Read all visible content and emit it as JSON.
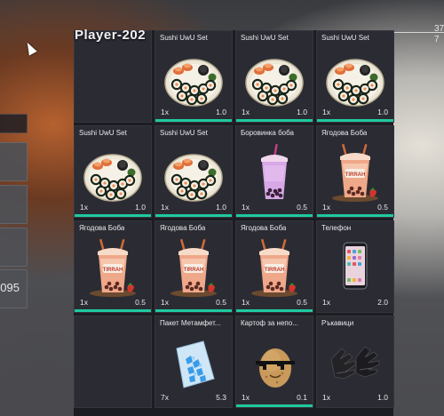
{
  "player_name": "Player-202",
  "left_panel_value": "095",
  "right_edge": {
    "line1": "37",
    "line2": "7"
  },
  "accent_color": "#1fc9a0",
  "slots": [
    {
      "kind": "empty"
    },
    {
      "kind": "item",
      "name": "Sushi UwU Set",
      "qty": "1x",
      "weight": "1.0",
      "icon": "sushi-platter",
      "bar": true
    },
    {
      "kind": "item",
      "name": "Sushi UwU Set",
      "qty": "1x",
      "weight": "1.0",
      "icon": "sushi-platter",
      "bar": true
    },
    {
      "kind": "item",
      "name": "Sushi UwU Set",
      "qty": "1x",
      "weight": "1.0",
      "icon": "sushi-platter",
      "bar": true
    },
    {
      "kind": "item",
      "name": "Sushi UwU Set",
      "qty": "1x",
      "weight": "1.0",
      "icon": "sushi-platter",
      "bar": true
    },
    {
      "kind": "item",
      "name": "Sushi UwU Set",
      "qty": "1x",
      "weight": "1.0",
      "icon": "sushi-platter",
      "bar": true
    },
    {
      "kind": "item",
      "name": "Боровинка боба",
      "qty": "1x",
      "weight": "0.5",
      "icon": "blueberry-boba",
      "bar": true
    },
    {
      "kind": "item",
      "name": "Ягодова Боба",
      "qty": "1x",
      "weight": "0.5",
      "icon": "berry-boba",
      "bar": true
    },
    {
      "kind": "item",
      "name": "Ягодова Боба",
      "qty": "1x",
      "weight": "0.5",
      "icon": "berry-boba",
      "bar": true
    },
    {
      "kind": "item",
      "name": "Ягодова Боба",
      "qty": "1x",
      "weight": "0.5",
      "icon": "berry-boba",
      "bar": true
    },
    {
      "kind": "item",
      "name": "Ягодова Боба",
      "qty": "1x",
      "weight": "0.5",
      "icon": "berry-boba",
      "bar": true
    },
    {
      "kind": "item",
      "name": "Телефон",
      "qty": "1x",
      "weight": "2.0",
      "icon": "phone",
      "bar": false
    },
    {
      "kind": "empty"
    },
    {
      "kind": "item",
      "name": "Пакет Метамфет...",
      "qty": "7x",
      "weight": "5.3",
      "icon": "blue-crystal-bag",
      "bar": false
    },
    {
      "kind": "item",
      "name": "Картоф за непо...",
      "qty": "1x",
      "weight": "0.1",
      "icon": "potato-sunglasses",
      "bar": true
    },
    {
      "kind": "item",
      "name": "Ръкавици",
      "qty": "1x",
      "weight": "1.0",
      "icon": "gloves",
      "bar": false
    }
  ]
}
